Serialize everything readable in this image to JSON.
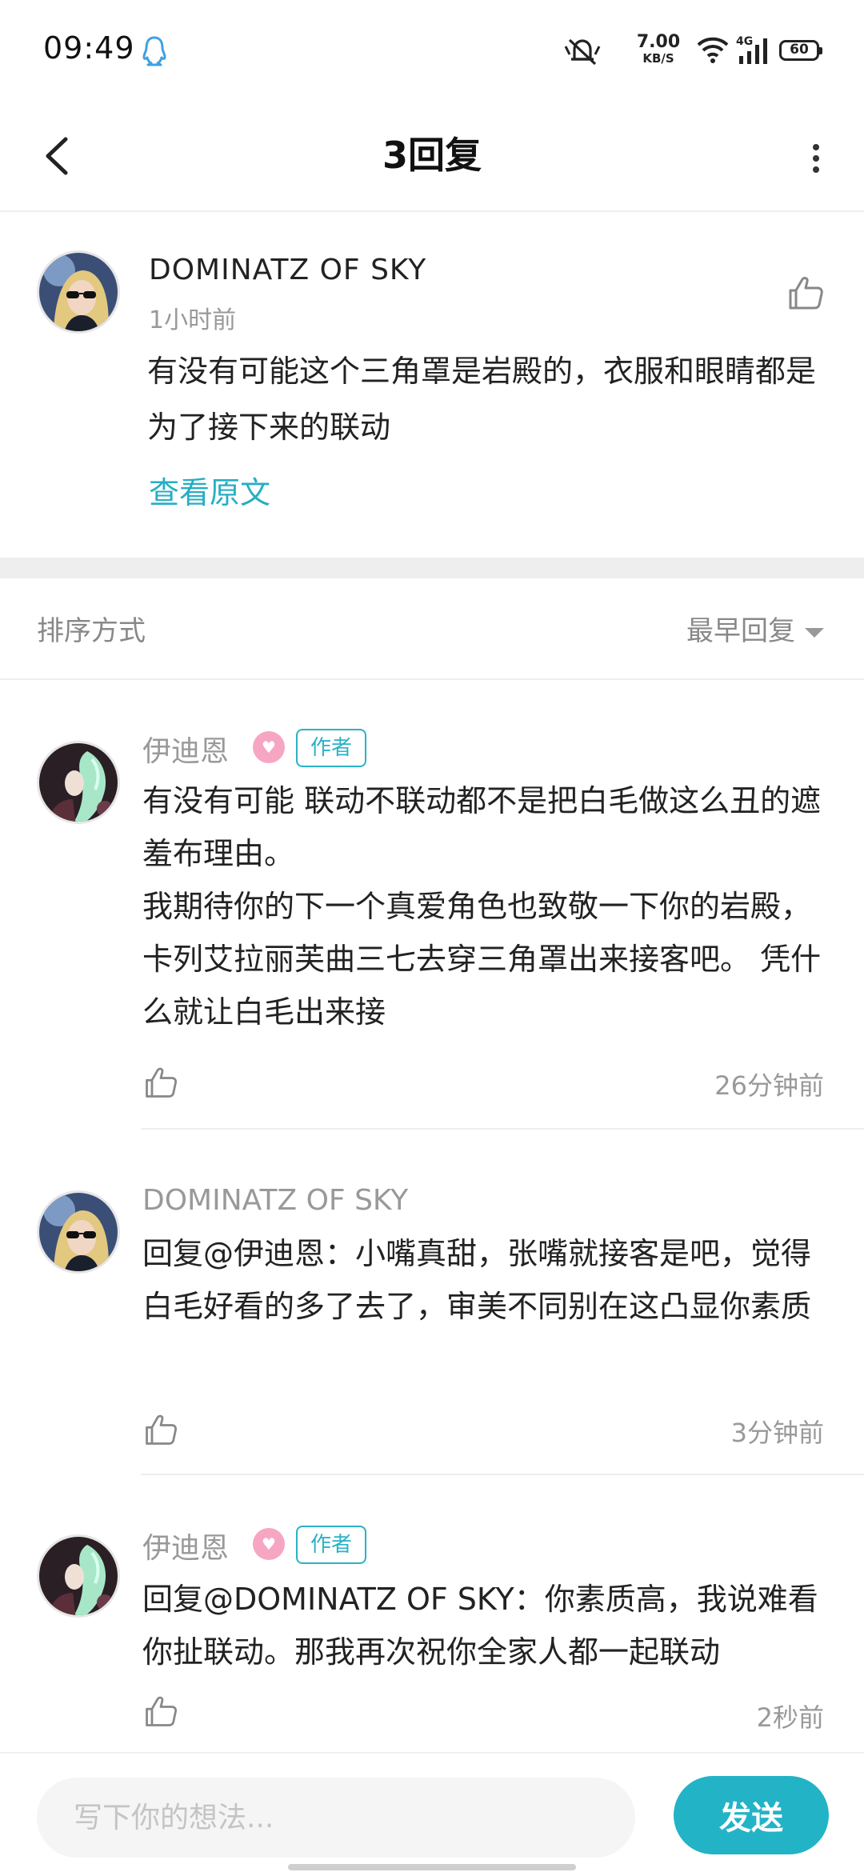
{
  "status_bar": {
    "time": "09:49",
    "net_speed": "7.00",
    "net_unit": "KB/S",
    "network_type": "4G",
    "battery": "60",
    "icons": [
      "qq-icon",
      "mute-icon",
      "wifi-icon",
      "signal-icon",
      "battery-icon"
    ]
  },
  "header": {
    "title": "3回复",
    "back_icon": "back-arrow-icon",
    "more_icon": "more-vertical-icon"
  },
  "main_comment": {
    "author": "DOMINATZ OF SKY",
    "time": "1小时前",
    "text": "有没有可能这个三角罩是岩殿的，衣服和眼睛都是为了接下来的联动",
    "view_original": "查看原文",
    "like_icon": "thumbs-up-icon"
  },
  "sort": {
    "label": "排序方式",
    "selected": "最早回复"
  },
  "replies": [
    {
      "author": "伊迪恩",
      "author_tag": "作者",
      "text_lines": [
        "有没有可能 联动不联动都不是把白毛做这么丑的遮羞布理由。",
        "我期待你的下一个真爱角色也致敬一下你的岩殿，卡列艾拉丽芙曲三七去穿三角罩出来接客吧。 凭什么就让白毛出来接"
      ],
      "time": "26分钟前"
    },
    {
      "author": "DOMINATZ OF SKY",
      "text_lines": [
        "回复@伊迪恩：小嘴真甜，张嘴就接客是吧，觉得白毛好看的多了去了，审美不同别在这凸显你素质"
      ],
      "time": "3分钟前"
    },
    {
      "author": "伊迪恩",
      "author_tag": "作者",
      "text_lines": [
        "回复@DOMINATZ OF SKY：你素质高，我说难看你扯联动。那我再次祝你全家人都一起联动"
      ],
      "time": "2秒前"
    }
  ],
  "composer": {
    "placeholder": "写下你的想法...",
    "send_label": "发送"
  },
  "colors": {
    "accent": "#22b3c6",
    "author_tag": "#2ab2c6",
    "badge_pink": "#f6a6c3",
    "muted_text": "#999999"
  }
}
